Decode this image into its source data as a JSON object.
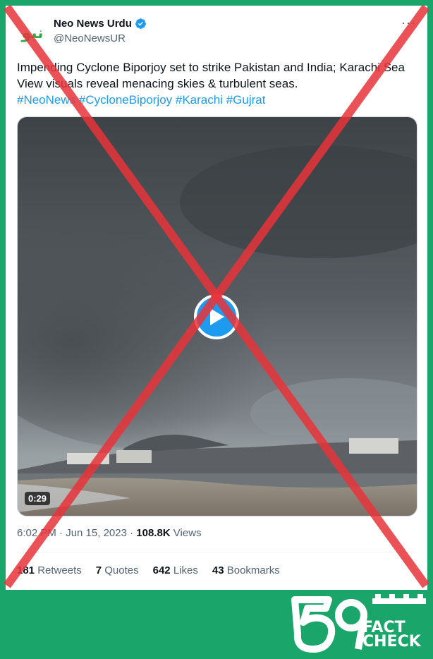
{
  "tweet": {
    "author_name": "Neo News Urdu",
    "handle": "@NeoNewsUR",
    "avatar_text": "نیو",
    "more": "···",
    "text": "Impending Cyclone Biporjoy set to strike Pakistan and India; Karachi Sea View visuals reveal menacing skies & turbulent seas.",
    "hashtags": "#NeoNews #CycloneBiporjoy #Karachi #Gujrat",
    "video_duration": "0:29",
    "timestamp": "6:02 PM · Jun 15, 2023 · ",
    "views_count": "108.8K",
    "views_label": " Views",
    "stats": [
      {
        "count": "181",
        "label": "Retweets"
      },
      {
        "count": "7",
        "label": "Quotes"
      },
      {
        "count": "642",
        "label": "Likes"
      },
      {
        "count": "43",
        "label": "Bookmarks"
      }
    ]
  },
  "fact_check_logo": {
    "number": "69",
    "line1": "FACT",
    "line2": "CHECK"
  },
  "colors": {
    "background_green": "#1aa56a",
    "cross_red": "#e8343a",
    "link_blue": "#1d9bf0"
  },
  "icons": [
    "verified-badge-icon",
    "play-icon",
    "more-icon"
  ]
}
